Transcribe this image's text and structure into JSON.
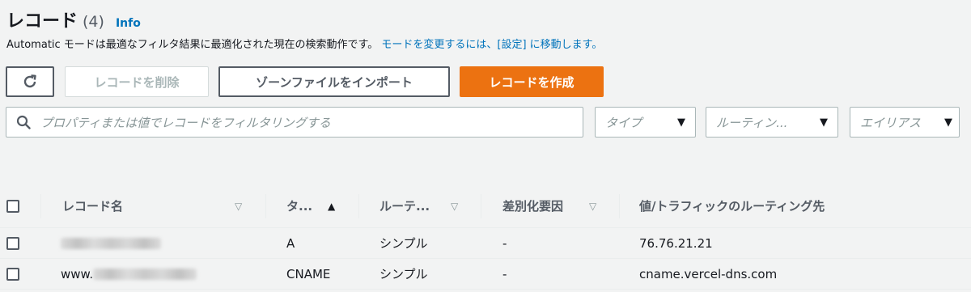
{
  "header": {
    "title": "レコード",
    "count": "(4)",
    "info": "Info",
    "description_text": "Automatic モードは最適なフィルタ結果に最適化された現在の検索動作です。",
    "description_link": "モードを変更するには、[設定] に移動します。"
  },
  "toolbar": {
    "refresh_icon": "refresh-icon",
    "delete_label": "レコードを削除",
    "import_label": "ゾーンファイルをインポート",
    "create_label": "レコードを作成",
    "create_color": "#ec7211"
  },
  "search": {
    "placeholder": "プロパティまたは値でレコードをフィルタリングする"
  },
  "filters": {
    "type": "タイプ",
    "routing": "ルーティン...",
    "alias": "エイリアス"
  },
  "table": {
    "columns": {
      "name": "レコード名",
      "type": "タ...",
      "routing": "ルーテ...",
      "diff": "差別化要因",
      "value": "値/トラフィックのルーティング先"
    },
    "rows": [
      {
        "name_prefix": "",
        "type": "A",
        "routing": "シンプル",
        "diff": "-",
        "value": "76.76.21.21"
      },
      {
        "name_prefix": "www.",
        "type": "CNAME",
        "routing": "シンプル",
        "diff": "-",
        "value": "cname.vercel-dns.com"
      }
    ]
  }
}
